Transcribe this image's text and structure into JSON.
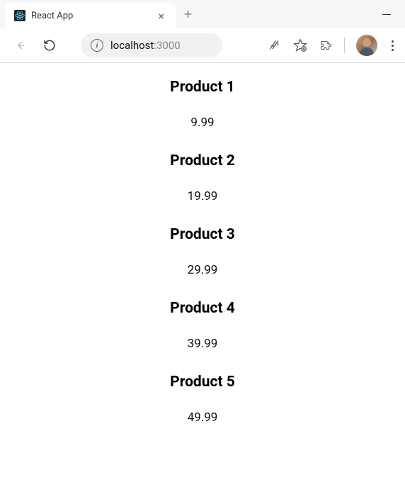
{
  "browser": {
    "tab": {
      "title": "React App",
      "close_symbol": "×"
    },
    "new_tab_symbol": "+",
    "address": {
      "host": "localhost",
      "port": ":3000"
    }
  },
  "products": [
    {
      "name": "Product 1",
      "price": "9.99"
    },
    {
      "name": "Product 2",
      "price": "19.99"
    },
    {
      "name": "Product 3",
      "price": "29.99"
    },
    {
      "name": "Product 4",
      "price": "39.99"
    },
    {
      "name": "Product 5",
      "price": "49.99"
    }
  ]
}
